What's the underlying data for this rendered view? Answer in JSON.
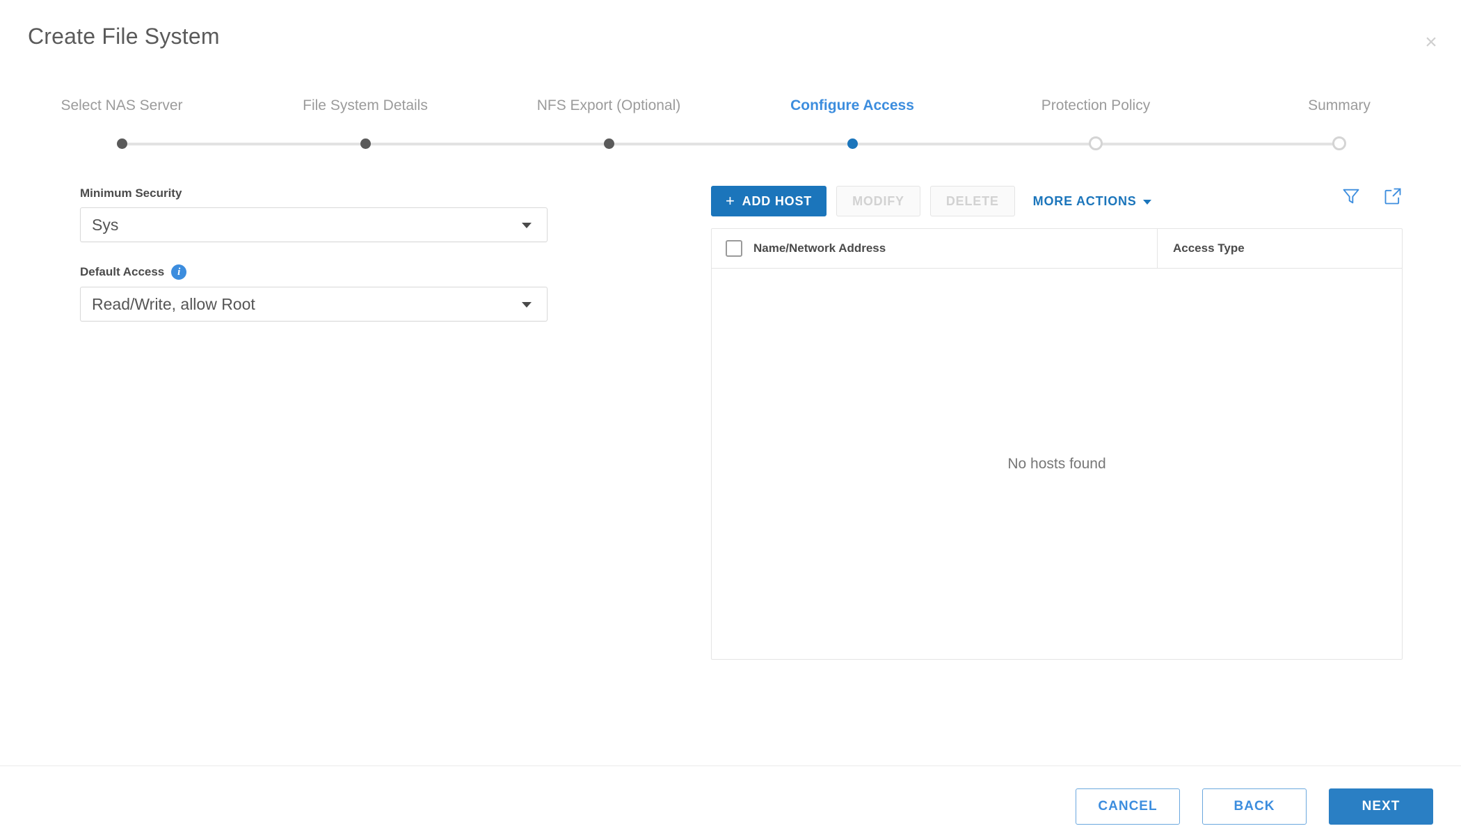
{
  "dialog": {
    "title": "Create File System",
    "close_label": "×"
  },
  "wizard": {
    "steps": [
      {
        "label": "Select NAS Server",
        "state": "done"
      },
      {
        "label": "File System Details",
        "state": "done"
      },
      {
        "label": "NFS Export (Optional)",
        "state": "done"
      },
      {
        "label": "Configure Access",
        "state": "active"
      },
      {
        "label": "Protection Policy",
        "state": "todo"
      },
      {
        "label": "Summary",
        "state": "todo"
      }
    ]
  },
  "form": {
    "minimum_security": {
      "label": "Minimum Security",
      "value": "Sys"
    },
    "default_access": {
      "label": "Default Access",
      "value": "Read/Write, allow Root",
      "info_glyph": "i"
    }
  },
  "hosts_panel": {
    "toolbar": {
      "add_host": "ADD HOST",
      "add_host_plus": "+",
      "modify": "MODIFY",
      "delete": "DELETE",
      "more_actions": "MORE ACTIONS",
      "filter_icon": "filter-icon",
      "export_icon": "export-icon"
    },
    "table": {
      "columns": [
        "Name/Network Address",
        "Access Type"
      ],
      "rows": [],
      "empty_message": "No hosts found"
    }
  },
  "footer": {
    "cancel": "CANCEL",
    "back": "BACK",
    "next": "NEXT"
  },
  "colors": {
    "accent": "#1b75bb",
    "link": "#3c8dde",
    "primary_button": "#2a7fc4",
    "step_done": "#5a5a5a",
    "step_todo_border": "#d4d4d4",
    "border": "#e4e4e4",
    "muted_text": "#9b9b9b"
  }
}
